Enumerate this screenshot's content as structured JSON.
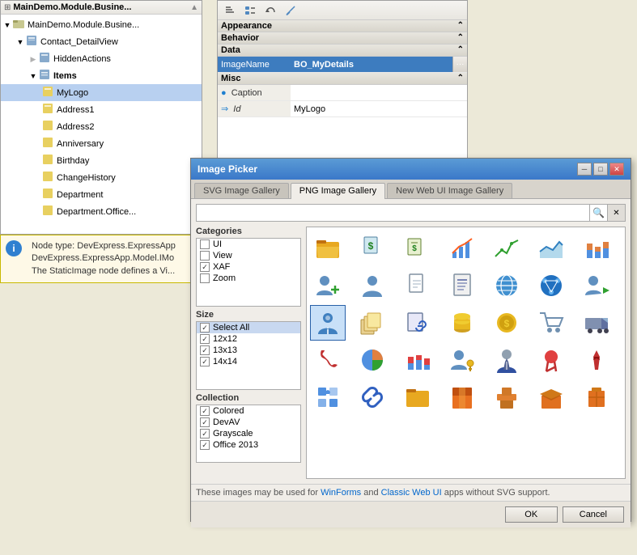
{
  "tree": {
    "title": "MainDemo.Module.Busine...",
    "items": [
      {
        "id": "root",
        "label": "MainDemo.Module.Busine...",
        "indent": 0,
        "icon": "folder",
        "expanded": true
      },
      {
        "id": "contact",
        "label": "Contact_DetailView",
        "indent": 1,
        "icon": "view",
        "expanded": true
      },
      {
        "id": "hidden",
        "label": "HiddenActions",
        "indent": 2,
        "icon": "folder-sm"
      },
      {
        "id": "items",
        "label": "Items",
        "indent": 2,
        "icon": "folder-sm",
        "expanded": true,
        "selected": false
      },
      {
        "id": "mylogo",
        "label": "MyLogo",
        "indent": 3,
        "icon": "page",
        "selected": true
      },
      {
        "id": "address1",
        "label": "Address1",
        "indent": 3,
        "icon": "page"
      },
      {
        "id": "address2",
        "label": "Address2",
        "indent": 3,
        "icon": "page"
      },
      {
        "id": "anniversary",
        "label": "Anniversary",
        "indent": 3,
        "icon": "page"
      },
      {
        "id": "birthday",
        "label": "Birthday",
        "indent": 3,
        "icon": "page"
      },
      {
        "id": "changehistory",
        "label": "ChangeHistory",
        "indent": 3,
        "icon": "page"
      },
      {
        "id": "department",
        "label": "Department",
        "indent": 3,
        "icon": "page"
      },
      {
        "id": "dept-office",
        "label": "Department.Office...",
        "indent": 3,
        "icon": "page"
      }
    ]
  },
  "property_grid": {
    "toolbar_buttons": [
      "sort-asc",
      "sort-cat",
      "undo",
      "link"
    ],
    "sections": [
      {
        "name": "Appearance",
        "collapsed": false,
        "rows": []
      },
      {
        "name": "Behavior",
        "collapsed": false,
        "rows": []
      },
      {
        "name": "Data",
        "collapsed": false,
        "rows": [
          {
            "key": "ImageName",
            "value": "BO_MyDetails",
            "selected": true,
            "has_btn": true
          }
        ]
      },
      {
        "name": "Misc",
        "collapsed": false,
        "rows": [
          {
            "key": "Caption",
            "value": "",
            "selected": false
          },
          {
            "key": "Id",
            "value": "MyLogo",
            "selected": false,
            "italic": true
          }
        ]
      }
    ]
  },
  "info_panel": {
    "title": "Node type: DevExpressApp...",
    "lines": [
      "Node type: DevExpress.ExpressApp",
      "DevExpress.ExpressApp.Model.IMo",
      "The StaticImage node defines a Vi..."
    ]
  },
  "dialog": {
    "title": "Image Picker",
    "tabs": [
      {
        "label": "SVG Image Gallery",
        "active": false
      },
      {
        "label": "PNG Image Gallery",
        "active": true
      },
      {
        "label": "New Web UI Image Gallery",
        "active": false
      }
    ],
    "search_placeholder": "",
    "filter": {
      "categories_title": "Categories",
      "categories": [
        {
          "label": "UI",
          "checked": false
        },
        {
          "label": "View",
          "checked": false
        },
        {
          "label": "XAF",
          "checked": true
        },
        {
          "label": "Zoom",
          "checked": false
        }
      ],
      "size_title": "Size",
      "sizes": [
        {
          "label": "Select All",
          "checked": true
        },
        {
          "label": "12x12",
          "checked": true
        },
        {
          "label": "13x13",
          "checked": true
        },
        {
          "label": "14x14",
          "checked": true
        }
      ],
      "collection_title": "Collection",
      "collections": [
        {
          "label": "Colored",
          "checked": true
        },
        {
          "label": "DevAV",
          "checked": true
        },
        {
          "label": "Grayscale",
          "checked": true
        },
        {
          "label": "Office 2013",
          "checked": true
        }
      ]
    },
    "footer_note": "These images may be used for WinForms and Classic Web UI apps without SVG support.",
    "buttons": [
      "OK",
      "Cancel"
    ],
    "images": [
      "folder-open",
      "dollar-doc",
      "dollar-doc2",
      "chart-bar",
      "chart-line",
      "chart-area",
      "chart-stack",
      "person-add",
      "person",
      "doc-blank",
      "doc-text",
      "globe-blue",
      "globe-network",
      "person-go",
      "person-info",
      "files-stack",
      "file-link",
      "coins-stack",
      "coins",
      "shopping-cart",
      "truck",
      "phone-red",
      "chart-pie",
      "chart-stacked",
      "person-key",
      "person-suit",
      "ribbon-red",
      "tie",
      "puzzle-blue",
      "link-blue",
      "folder-yellow",
      "box-orange",
      "box-stack",
      "box-open",
      "box-ship",
      "box-label"
    ]
  }
}
